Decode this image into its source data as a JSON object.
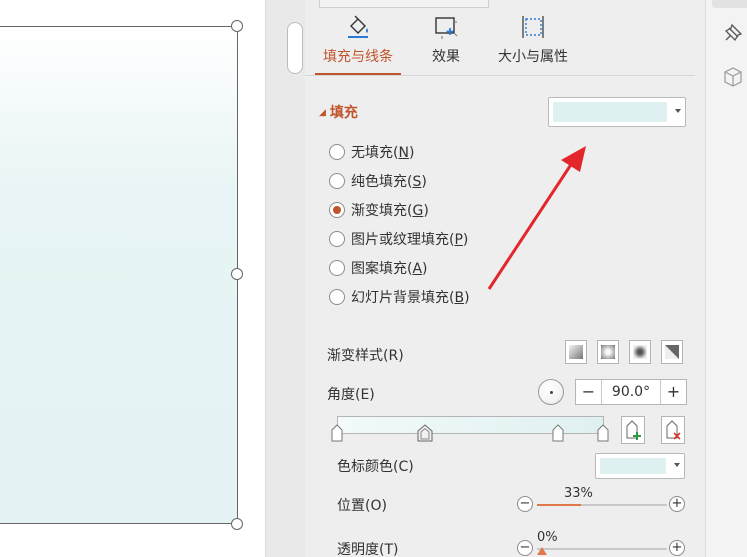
{
  "tabs": [
    {
      "label": "填充与线条",
      "icon": "fill-bucket-icon",
      "active": true
    },
    {
      "label": "效果",
      "icon": "effects-icon",
      "active": false
    },
    {
      "label": "大小与属性",
      "icon": "size-properties-icon",
      "active": false
    }
  ],
  "fill_section": {
    "title": "填充",
    "color_swatch": "#dff0f1",
    "options": [
      {
        "label": "无填充",
        "key": "N",
        "selected": false
      },
      {
        "label": "纯色填充",
        "key": "S",
        "selected": false
      },
      {
        "label": "渐变填充",
        "key": "G",
        "selected": true
      },
      {
        "label": "图片或纹理填充",
        "key": "P",
        "selected": false
      },
      {
        "label": "图案填充",
        "key": "A",
        "selected": false
      },
      {
        "label": "幻灯片背景填充",
        "key": "B",
        "selected": false
      }
    ]
  },
  "gradient": {
    "style_label": "渐变样式(R)",
    "angle_label": "角度(E)",
    "angle_value": "90.0°",
    "color_label": "色标颜色(C)",
    "position_label": "位置(O)",
    "position_value": "33%",
    "transparency_label": "透明度(T)",
    "transparency_value": "0%"
  },
  "colors": {
    "accent": "#c0542b",
    "panel_bg": "#eeeeee",
    "swatch": "#dff0f1",
    "annotation_arrow": "#e3262b"
  },
  "right_strip_icons": [
    "pin-icon",
    "cube-icon"
  ]
}
